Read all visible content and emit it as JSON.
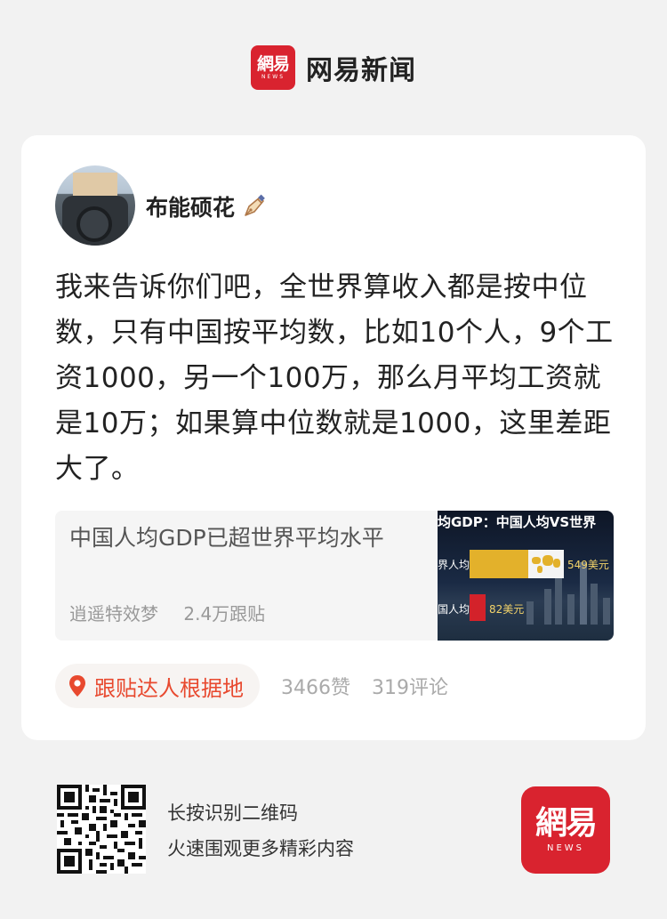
{
  "header": {
    "logo_cn": "網易",
    "logo_en": "NEWS",
    "brand_name": "网易新闻"
  },
  "post": {
    "username": "布能硕花",
    "badge_icon": "pen-icon",
    "text": "我来告诉你们吧，全世界算收入都是按中位数，只有中国按平均数，比如10个人，9个工资1000，另一个100万，那么月平均工资就是10万；如果算中位数就是1000，这里差距大了。",
    "linked_topic": {
      "title": "中国人均GDP已超世界平均水平",
      "author": "逍遥特效梦",
      "replies": "2.4万跟贴",
      "thumbnail": {
        "title": "均GDP：中国人均VS世界",
        "row1_label": "界人均",
        "row1_value": "549美元",
        "row2_label": "国人均",
        "row2_value": "82美元"
      }
    },
    "topic_pill": "跟贴达人根据地",
    "likes": "3466赞",
    "comments": "319评论"
  },
  "footer": {
    "qr_line1": "长按识别二维码",
    "qr_line2": "火速围观更多精彩内容",
    "app_cn": "網易",
    "app_en": "NEWS"
  },
  "colors": {
    "brand_red": "#d9232f",
    "accent_orange": "#e8492f"
  }
}
